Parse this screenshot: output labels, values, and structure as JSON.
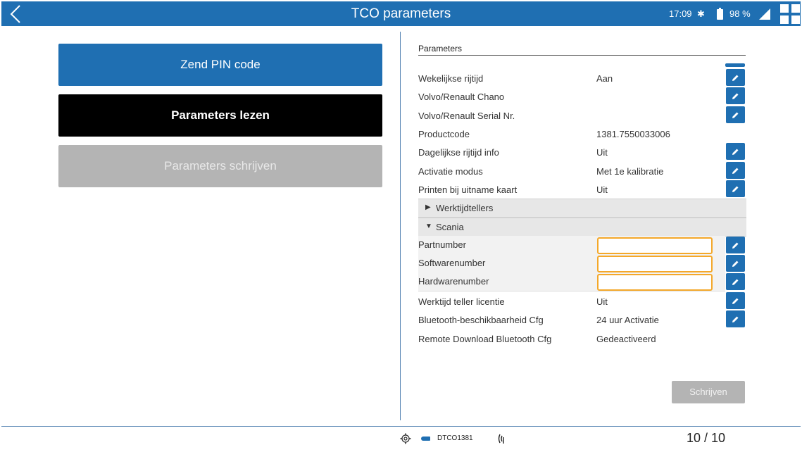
{
  "header": {
    "title": "TCO parameters",
    "time": "17:09",
    "bluetooth_symbol": "✱",
    "battery_pct": "98 %",
    "accent": "#1f6fb2"
  },
  "actions": {
    "send_pin": "Zend PIN code",
    "read_params": "Parameters lezen",
    "write_params": "Parameters schrijven"
  },
  "params": {
    "section_title": "Parameters",
    "rows": [
      {
        "label": "Wekelijkse rijtijd",
        "value": "Aan"
      },
      {
        "label": "Volvo/Renault Chano",
        "value": ""
      },
      {
        "label": "Volvo/Renault Serial Nr.",
        "value": ""
      },
      {
        "label": "Productcode",
        "value": "1381.7550033006"
      },
      {
        "label": "Dagelijkse rijtijd info",
        "value": "Uit"
      },
      {
        "label": "Activatie modus",
        "value": "Met 1e kalibratie"
      },
      {
        "label": "Printen bij uitname kaart",
        "value": "Uit"
      }
    ],
    "groups": [
      {
        "label": "Werktijdtellers",
        "arrow": "▶"
      },
      {
        "label": "Scania",
        "arrow": "▼"
      }
    ],
    "scania_rows": [
      {
        "label": "Partnumber",
        "value": ""
      },
      {
        "label": "Softwarenumber",
        "value": ""
      },
      {
        "label": "Hardwarenumber",
        "value": ""
      }
    ],
    "rows2": [
      {
        "label": "Werktijd teller licentie",
        "value": "Uit"
      },
      {
        "label": "Bluetooth-beschikbaarheid Cfg",
        "value": "24 uur Activatie"
      },
      {
        "label": "Remote Download Bluetooth Cfg",
        "value": "Gedeactiveerd"
      }
    ],
    "write_label": "Schrijven"
  },
  "footer": {
    "device": "DTCO1381",
    "page": "10 / 10"
  }
}
